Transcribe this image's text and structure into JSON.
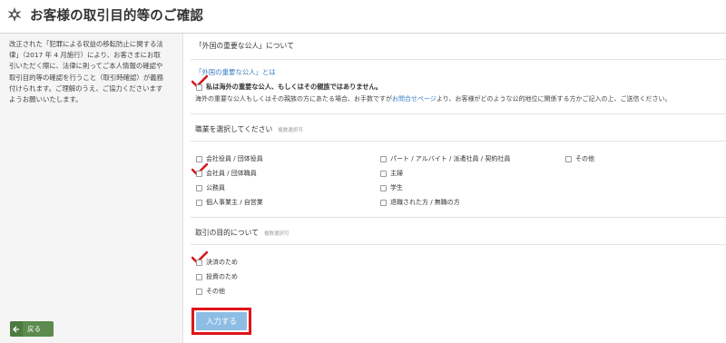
{
  "header": {
    "title": "お客様の取引目的等のご確認"
  },
  "sidebar": {
    "lines": [
      "改正された「犯罪による収益の移転防止に関する法",
      "律」（2017 年 4 月施行）により、お客さまにお取",
      "引いただく際に、法律に則ってご本人情報の確認や",
      "取引目的等の確認を行うこと（取引時確認）が義務",
      "付けられます。ご理解のうえ、ご協力くださいます",
      "ようお願いいたします。"
    ],
    "back_label": "戻る"
  },
  "pep": {
    "heading": "「外国の重要な公人」について",
    "link": "「外国の重要な公人」とは",
    "checkbox_label": "私は海外の重要な公人、もしくはその親族ではありません。",
    "notice_before": "海外の重要な公人もしくはその親族の方にあたる場合、お手数ですが",
    "notice_link": "お問合せページ",
    "notice_after": "より、お客様がどのような公的地位に関係する方かご記入の上、ご送信ください。"
  },
  "occupation": {
    "heading": "職業を選択してください",
    "hint": "複数選択可",
    "options": [
      "会社役員 / 団体役員",
      "会社員 / 団体職員",
      "公務員",
      "個人事業主 / 自営業",
      "パート / アルバイト / 派遣社員 / 契約社員",
      "主婦",
      "学生",
      "退職された方 / 無職の方",
      "その他"
    ],
    "checked_index": 1
  },
  "purpose": {
    "heading": "取引の目的について",
    "hint": "複数選択可",
    "options": [
      "決済のため",
      "投資のため",
      "その他"
    ],
    "checked_index": 0
  },
  "submit_label": "入力する",
  "colors": {
    "check_mark": "#d11a1a",
    "link": "#3a7fc1",
    "submit": "#8dbde4",
    "submit_outline": "#e0141b",
    "back_button": "#5c8b4d"
  },
  "icons": {
    "header": "gear-icon",
    "back": "arrow-left-icon",
    "check": "checkmark-icon"
  }
}
